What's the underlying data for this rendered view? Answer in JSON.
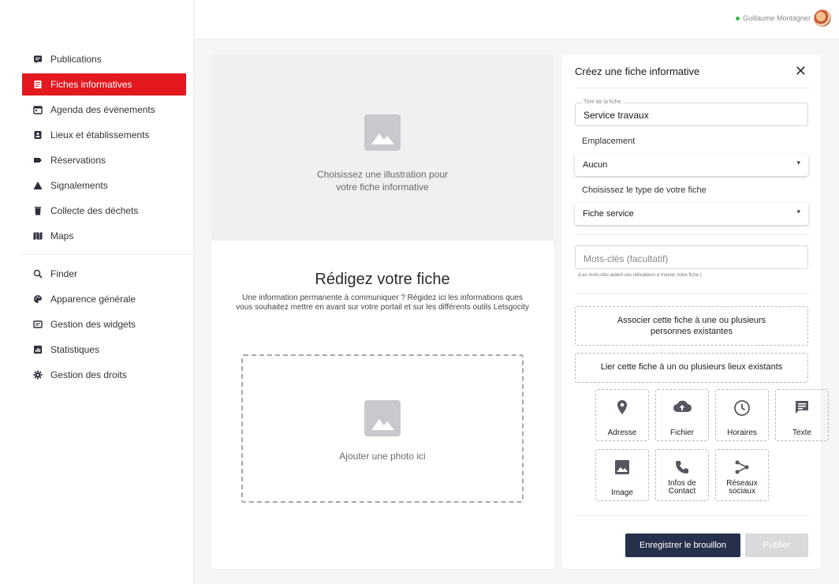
{
  "sidebar": {
    "items": [
      {
        "label": "Publications",
        "icon": "message-square-icon"
      },
      {
        "label": "Fiches informatives",
        "icon": "document-icon",
        "active": true
      },
      {
        "label": "Agenda des évènements",
        "icon": "calendar-icon"
      },
      {
        "label": "Lieux et établissements",
        "icon": "place-badge-icon"
      },
      {
        "label": "Réservations",
        "icon": "tag-icon"
      },
      {
        "label": "Signalements",
        "icon": "warning-icon"
      },
      {
        "label": "Collecte des déchets",
        "icon": "trash-icon"
      },
      {
        "label": "Maps",
        "icon": "map-icon"
      }
    ],
    "items2": [
      {
        "label": "Finder",
        "icon": "search-icon"
      },
      {
        "label": "Apparence générale",
        "icon": "palette-icon"
      },
      {
        "label": "Gestion des widgets",
        "icon": "widgets-icon"
      },
      {
        "label": "Statistiques",
        "icon": "chart-icon"
      },
      {
        "label": "Gestion des droits",
        "icon": "gear-icon"
      }
    ],
    "accent": "#e3191f"
  },
  "header": {
    "user_name": "Guillaume Montagner",
    "status_color": "#3cb44b"
  },
  "editor": {
    "illustration_text_1": "Choisissez une illustration pour",
    "illustration_text_2": "votre fiche informative",
    "title": "Rédigez votre fiche",
    "description": "Une information permanente à communiquer ? Régidez ici les informations ques vous souhaitez mettre en avant sur votre portail et sur les différents outils Letsgocity",
    "dropzone_text": "Ajouter une photo ici"
  },
  "panel": {
    "title": "Créez une fiche informative",
    "close_icon": "close-icon",
    "titre_legend": "Titre de la fiche",
    "titre_value": "Service travaux",
    "emplacement_label": "Emplacement",
    "emplacement_value": "Aucun",
    "type_label": "Choisissez le type de votre fiche",
    "type_value": "Fiche service",
    "keywords_placeholder": "Mots-clés (facultatif)",
    "keywords_helper": "(Les mots-clés aident vos utilisateurs à trouver votre fiche )",
    "associate_label": "Associer cette fiche à une ou plusieurs personnes existantes",
    "link_places_label": "Lier cette fiche à un ou plusieurs lieux existants",
    "tiles": [
      {
        "label": "Adresse",
        "icon": "location-pin-icon"
      },
      {
        "label": "Fichier",
        "icon": "cloud-upload-icon"
      },
      {
        "label": "Horaires",
        "icon": "clock-icon"
      },
      {
        "label": "Texte",
        "icon": "text-comment-icon"
      },
      {
        "label": "Image",
        "icon": "image-icon"
      },
      {
        "label": "Infos de Contact",
        "icon": "phone-icon"
      },
      {
        "label": "Réseaux sociaux",
        "icon": "share-icon"
      }
    ],
    "save_draft_label": "Enregistrer le brouillon",
    "publish_label": "Publier"
  }
}
